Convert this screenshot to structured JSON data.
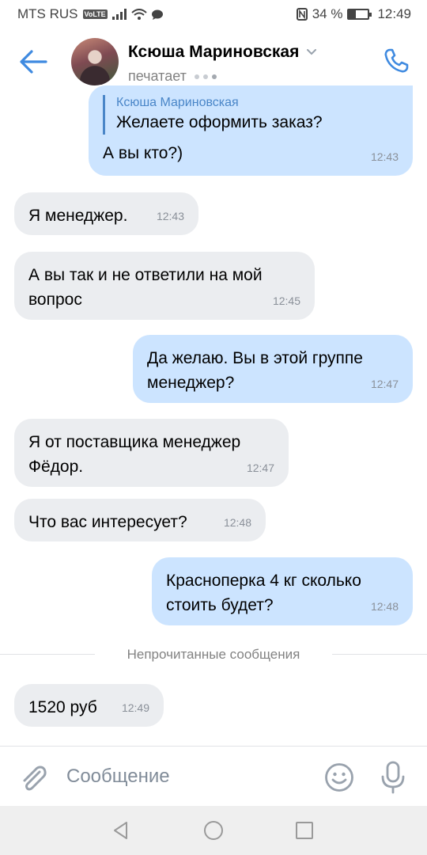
{
  "status_bar": {
    "carrier": "MTS RUS",
    "volte": "VoLTE",
    "battery": "34 %",
    "battery_level": 0.34,
    "time": "12:49"
  },
  "header": {
    "title": "Ксюша Мариновская",
    "status": "печатает"
  },
  "messages": [
    {
      "type": "out",
      "reply_name": "Ксюша Мариновская",
      "reply_text": "Желаете оформить заказ?",
      "text": "А вы кто?)",
      "time": "12:43"
    },
    {
      "type": "in",
      "text": "Я менеджер.",
      "time": "12:43"
    },
    {
      "type": "in",
      "text": "А вы так и не ответили на мой вопрос",
      "time": "12:45"
    },
    {
      "type": "out",
      "text": "Да желаю. Вы в этой группе менеджер?",
      "time": "12:47"
    },
    {
      "type": "in",
      "text": "Я от поставщика менеджер Фёдор.",
      "time": "12:47"
    },
    {
      "type": "in",
      "text": "Что вас интересует?",
      "time": "12:48"
    },
    {
      "type": "out",
      "text": "Красноперка 4 кг сколько стоить будет?",
      "time": "12:48"
    },
    {
      "type": "in",
      "text": "1520 руб",
      "time": "12:49"
    }
  ],
  "divider": {
    "label": "Непрочитанные сообщения"
  },
  "composer": {
    "placeholder": "Сообщение"
  },
  "colors": {
    "accent": "#3f8ae0",
    "incoming_bubble": "#ebedf0",
    "outgoing_bubble": "#cce4ff"
  },
  "icons": {
    "back": "arrow-left-icon",
    "call": "phone-icon",
    "attach": "paperclip-icon",
    "emoji": "smile-icon",
    "mic": "microphone-icon"
  }
}
